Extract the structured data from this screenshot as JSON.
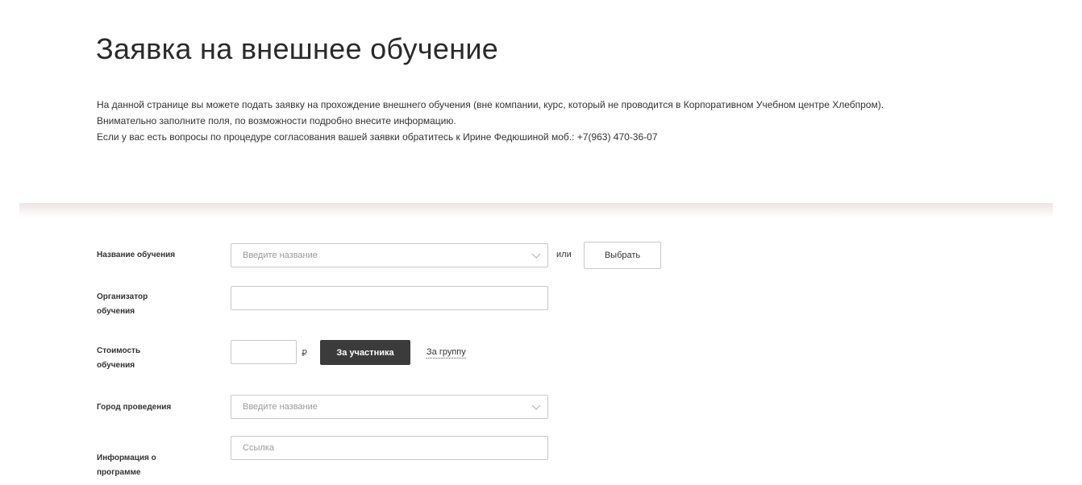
{
  "page": {
    "title": "Заявка на внешнее обучение",
    "intro": [
      "На данной странице вы можете подать заявку на прохождение внешнего обучения (вне компании, курс, который не проводится в Корпоративном Учебном центре Хлебпром).",
      "Внимательно заполните поля, по возможности подробно внесите информацию.",
      "Если у вас есть вопросы по процедуре согласования вашей заявки обратитесь к Ирине Федюшиной моб.: +7(963) 470-36-07"
    ]
  },
  "form": {
    "training_name": {
      "label": "Название обучения",
      "placeholder": "Введите название",
      "icon": "chevron-down-icon",
      "or_text": "или",
      "choose_button": "Выбрать"
    },
    "organizer": {
      "label_line1": "Организатор",
      "label_line2": "обучения",
      "value": ""
    },
    "cost": {
      "label_line1": "Стоимость",
      "label_line2": "обучения",
      "value": "",
      "currency": "₽",
      "per_participant_button": "За участника",
      "per_group_link": "За группу"
    },
    "city": {
      "label": "Город проведения",
      "placeholder": "Введите название",
      "icon": "chevron-down-icon"
    },
    "program_info": {
      "label_line1": "Информация о",
      "label_line2": "программе",
      "placeholder": "Ссылка"
    }
  }
}
